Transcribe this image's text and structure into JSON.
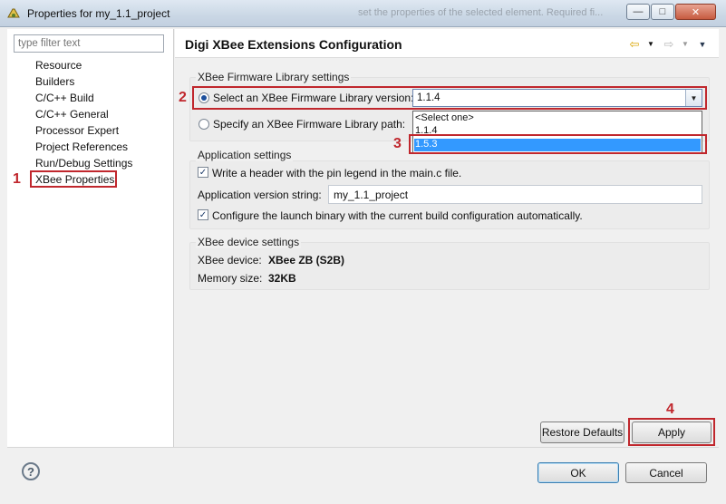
{
  "window": {
    "title": "Properties for my_1.1_project",
    "ghost_text": "set the properties of the selected element. Required fi..."
  },
  "filter": {
    "placeholder": "type filter text"
  },
  "tree": {
    "items": [
      "Resource",
      "Builders",
      "C/C++ Build",
      "C/C++ General",
      "Processor Expert",
      "Project References",
      "Run/Debug Settings",
      "XBee Properties"
    ],
    "selected": "XBee Properties"
  },
  "annotations": [
    "1",
    "2",
    "3",
    "4"
  ],
  "page": {
    "title": "Digi XBee Extensions Configuration"
  },
  "firmware": {
    "group_label": "XBee Firmware Library settings",
    "select_version_label": "Select an XBee Firmware Library version:",
    "selected_version": "1.1.4",
    "options": [
      "<Select one>",
      "1.1.4",
      "1.5.3"
    ],
    "highlighted_option": "1.5.3",
    "specify_path_label": "Specify an XBee Firmware Library path:"
  },
  "app_settings": {
    "group_label": "Application settings",
    "write_header_label": "Write a header with the pin legend in the main.c file.",
    "version_string_label": "Application version string:",
    "version_string_value": "my_1.1_project",
    "configure_launch_label": "Configure the launch binary with the current build configuration automatically."
  },
  "device": {
    "group_label": "XBee device settings",
    "device_label": "XBee device:",
    "device_value": "XBee ZB (S2B)",
    "memory_label": "Memory size:",
    "memory_value": "32KB"
  },
  "buttons": {
    "restore_defaults": "Restore Defaults",
    "apply": "Apply",
    "ok": "OK",
    "cancel": "Cancel"
  },
  "colors": {
    "annotation": "#c0272d",
    "highlight": "#3399ff"
  }
}
